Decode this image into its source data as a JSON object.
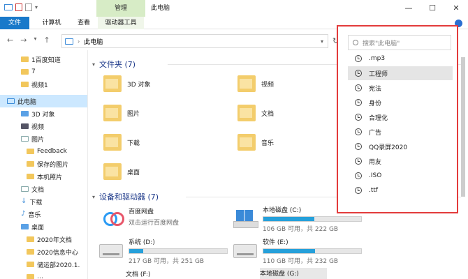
{
  "window": {
    "title": "此电脑",
    "manage_tab": "管理",
    "minimize": "—",
    "maximize": "☐",
    "close": "✕"
  },
  "ribbon": {
    "tabs": [
      "文件",
      "计算机",
      "查看",
      "驱动器工具"
    ]
  },
  "address": {
    "location": "此电脑"
  },
  "nav": {
    "items": [
      {
        "label": "1百度知道",
        "icon": "folder-icon"
      },
      {
        "label": "7",
        "icon": "folder-icon"
      },
      {
        "label": "视频1",
        "icon": "folder-icon"
      },
      {
        "label": "此电脑",
        "icon": "computer-icon"
      },
      {
        "label": "3D 对象",
        "icon": "3d-objects-icon"
      },
      {
        "label": "视频",
        "icon": "video-icon"
      },
      {
        "label": "图片",
        "icon": "pictures-icon"
      },
      {
        "label": "Feedback",
        "icon": "folder-icon"
      },
      {
        "label": "保存的图片",
        "icon": "folder-icon"
      },
      {
        "label": "本机照片",
        "icon": "folder-icon"
      },
      {
        "label": "文档",
        "icon": "documents-icon"
      },
      {
        "label": "下载",
        "icon": "download-icon"
      },
      {
        "label": "音乐",
        "icon": "music-icon"
      },
      {
        "label": "桌面",
        "icon": "desktop-icon"
      },
      {
        "label": "2020年文档",
        "icon": "folder-icon"
      },
      {
        "label": "2020信息中心",
        "icon": "folder-icon"
      },
      {
        "label": "储运部2020.1.",
        "icon": "folder-icon"
      },
      {
        "label": "…",
        "icon": "folder-icon"
      }
    ]
  },
  "folders": {
    "title": "文件夹 (7)",
    "items": [
      "3D 对象",
      "视频",
      "图片",
      "文档",
      "下载",
      "音乐",
      "桌面"
    ]
  },
  "devices": {
    "title": "设备和驱动器 (7)",
    "baidu": {
      "name": "百度网盘",
      "sub": "双击运行百度网盘"
    },
    "drives": [
      {
        "name": "本地磁盘 (C:)",
        "space": "106 GB 可用，共 222 GB",
        "used": 0.52
      },
      {
        "name": "系统 (D:)",
        "space": "217 GB 可用，共 251 GB",
        "used": 0.14
      },
      {
        "name": "软件 (E:)",
        "space": "110 GB 可用，共 232 GB",
        "used": 0.53
      },
      {
        "name": "文档 (F:)"
      },
      {
        "name": "本地磁盘 (G:)"
      }
    ]
  },
  "search": {
    "placeholder": "搜索\"此电脑\"",
    "history": [
      ".mp3",
      "工程师",
      "宪法",
      "身份",
      "合理化",
      "广告",
      "QQ录屏2020",
      "用友",
      ".ISO",
      ".ttf"
    ],
    "highlighted_index": 1
  },
  "colors": {
    "accent": "#1979ca",
    "highlight_border": "#e33b3b",
    "drive_bar": "#26a0da"
  }
}
